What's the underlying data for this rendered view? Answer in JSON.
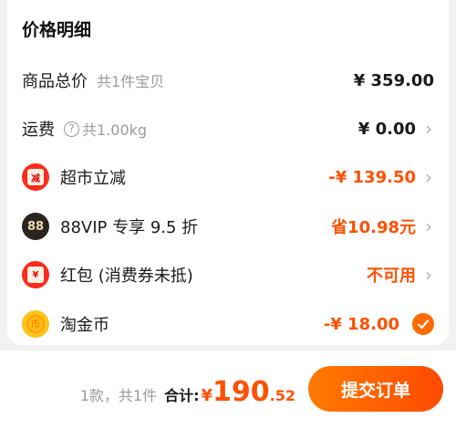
{
  "card": {
    "title": "价格明细"
  },
  "rows": [
    {
      "label": "商品总价",
      "sub": "共1件宝贝",
      "value": "¥ 359.00"
    },
    {
      "label": "运费",
      "sub": "共1.00kg",
      "value": "¥ 0.00",
      "help_glyph": "?"
    },
    {
      "label": "超市立减",
      "badge_text": "减",
      "value": "-¥ 139.50"
    },
    {
      "label": "88VIP 专享 9.5 折",
      "badge_text": "88",
      "value": "省10.98元"
    },
    {
      "label": "红包 (消费券未抵)",
      "badge_text": "¥",
      "value": "不可用"
    },
    {
      "label": "淘金币",
      "badge_text": "币",
      "value": "-¥ 18.00"
    }
  ],
  "icons": {
    "chevron": "›",
    "names": [
      "help-icon",
      "supermarket-discount-icon",
      "vip88-icon",
      "red-packet-icon",
      "taojinbi-coin-icon",
      "checkmark-icon",
      "chevron-right-icon"
    ]
  },
  "bottom": {
    "count": "1款，共1件",
    "total_label": "合计:",
    "currency": "¥",
    "amount_int": "190",
    "amount_dec": ".52",
    "submit_label": "提交订单"
  },
  "colors": {
    "accent": "#ff5000",
    "button_start": "#ff7a00",
    "button_end": "#ff4a00"
  }
}
